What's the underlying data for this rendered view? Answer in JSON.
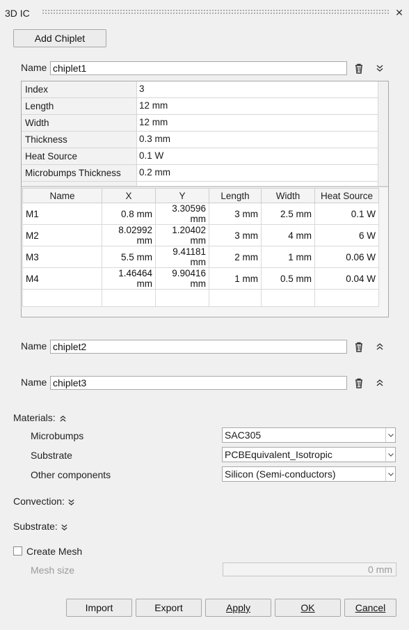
{
  "window": {
    "title": "3D IC"
  },
  "toolbar": {
    "add_chiplet": "Add Chiplet"
  },
  "chiplets": [
    {
      "name_label": "Name",
      "name": "chiplet1",
      "expanded": true
    },
    {
      "name_label": "Name",
      "name": "chiplet2",
      "expanded": false
    },
    {
      "name_label": "Name",
      "name": "chiplet3",
      "expanded": false
    }
  ],
  "properties": [
    {
      "key": "Index",
      "value": "3"
    },
    {
      "key": "Length",
      "value": "12 mm"
    },
    {
      "key": "Width",
      "value": "12 mm"
    },
    {
      "key": "Thickness",
      "value": "0.3 mm"
    },
    {
      "key": "Heat Source",
      "value": "0.1 W"
    },
    {
      "key": "Microbumps Thickness",
      "value": "0.2 mm"
    }
  ],
  "microbumps": {
    "headers": [
      "Name",
      "X",
      "Y",
      "Length",
      "Width",
      "Heat Source"
    ],
    "rows": [
      [
        "M1",
        "0.8 mm",
        "3.30596 mm",
        "3 mm",
        "2.5 mm",
        "0.1 W"
      ],
      [
        "M2",
        "8.02992 mm",
        "1.20402 mm",
        "3 mm",
        "4 mm",
        "6 W"
      ],
      [
        "M3",
        "5.5 mm",
        "9.41181 mm",
        "2 mm",
        "1 mm",
        "0.06 W"
      ],
      [
        "M4",
        "1.46464 mm",
        "9.90416 mm",
        "1 mm",
        "0.5 mm",
        "0.04 W"
      ],
      [
        "",
        "",
        "",
        "",
        "",
        ""
      ]
    ]
  },
  "materials": {
    "label": "Materials:",
    "items": [
      {
        "label": "Microbumps",
        "value": "SAC305"
      },
      {
        "label": "Substrate",
        "value": "PCBEquivalent_Isotropic"
      },
      {
        "label": "Other components",
        "value": "Silicon (Semi-conductors)"
      }
    ]
  },
  "convection": {
    "label": "Convection:"
  },
  "substrate": {
    "label": "Substrate:"
  },
  "mesh": {
    "create_label": "Create Mesh",
    "checked": false,
    "size_label": "Mesh size",
    "size_value": "0 mm"
  },
  "footer": {
    "import": "Import",
    "export": "Export",
    "apply": "Apply",
    "ok": "OK",
    "cancel": "Cancel"
  }
}
